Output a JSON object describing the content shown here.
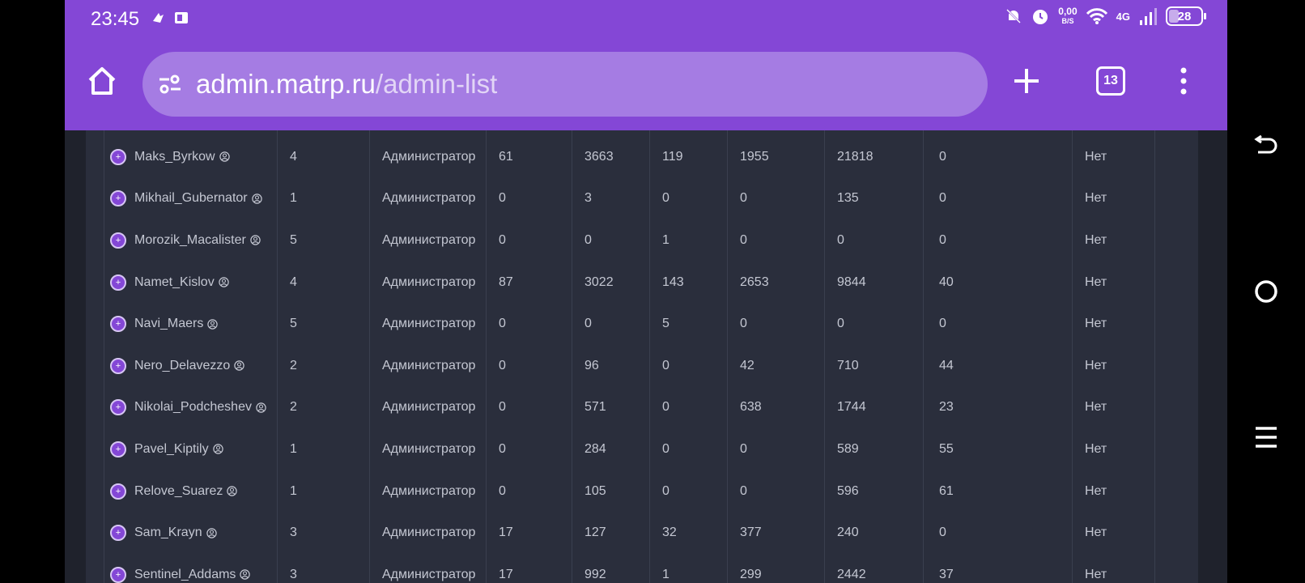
{
  "status_bar": {
    "time": "23:45",
    "speed_value": "0,00",
    "speed_unit": "B/S",
    "network": "4G",
    "battery": "28"
  },
  "browser": {
    "url_domain": "admin.matrp.ru",
    "url_path": "/admin-list",
    "tab_count": "13"
  },
  "table": {
    "rows": [
      {
        "name": "Maks_Byrkow",
        "level": "4",
        "role": "Администратор",
        "c1": "61",
        "c2": "3663",
        "c3": "119",
        "c4": "1955",
        "c5": "21818",
        "c6": "0",
        "status": "Нет"
      },
      {
        "name": "Mikhail_Gubernator",
        "level": "1",
        "role": "Администратор",
        "c1": "0",
        "c2": "3",
        "c3": "0",
        "c4": "0",
        "c5": "135",
        "c6": "0",
        "status": "Нет"
      },
      {
        "name": "Morozik_Macalister",
        "level": "5",
        "role": "Администратор",
        "c1": "0",
        "c2": "0",
        "c3": "1",
        "c4": "0",
        "c5": "0",
        "c6": "0",
        "status": "Нет"
      },
      {
        "name": "Namet_Kislov",
        "level": "4",
        "role": "Администратор",
        "c1": "87",
        "c2": "3022",
        "c3": "143",
        "c4": "2653",
        "c5": "9844",
        "c6": "40",
        "status": "Нет"
      },
      {
        "name": "Navi_Maers",
        "level": "5",
        "role": "Администратор",
        "c1": "0",
        "c2": "0",
        "c3": "5",
        "c4": "0",
        "c5": "0",
        "c6": "0",
        "status": "Нет"
      },
      {
        "name": "Nero_Delavezzo",
        "level": "2",
        "role": "Администратор",
        "c1": "0",
        "c2": "96",
        "c3": "0",
        "c4": "42",
        "c5": "710",
        "c6": "44",
        "status": "Нет"
      },
      {
        "name": "Nikolai_Podcheshev",
        "level": "2",
        "role": "Администратор",
        "c1": "0",
        "c2": "571",
        "c3": "0",
        "c4": "638",
        "c5": "1744",
        "c6": "23",
        "status": "Нет"
      },
      {
        "name": "Pavel_Kiptily",
        "level": "1",
        "role": "Администратор",
        "c1": "0",
        "c2": "284",
        "c3": "0",
        "c4": "0",
        "c5": "589",
        "c6": "55",
        "status": "Нет"
      },
      {
        "name": "Relove_Suarez",
        "level": "1",
        "role": "Администратор",
        "c1": "0",
        "c2": "105",
        "c3": "0",
        "c4": "0",
        "c5": "596",
        "c6": "61",
        "status": "Нет"
      },
      {
        "name": "Sam_Krayn",
        "level": "3",
        "role": "Администратор",
        "c1": "17",
        "c2": "127",
        "c3": "32",
        "c4": "377",
        "c5": "240",
        "c6": "0",
        "status": "Нет"
      },
      {
        "name": "Sentinel_Addams",
        "level": "3",
        "role": "Администратор",
        "c1": "17",
        "c2": "992",
        "c3": "1",
        "c4": "299",
        "c5": "2442",
        "c6": "37",
        "status": "Нет"
      }
    ]
  }
}
